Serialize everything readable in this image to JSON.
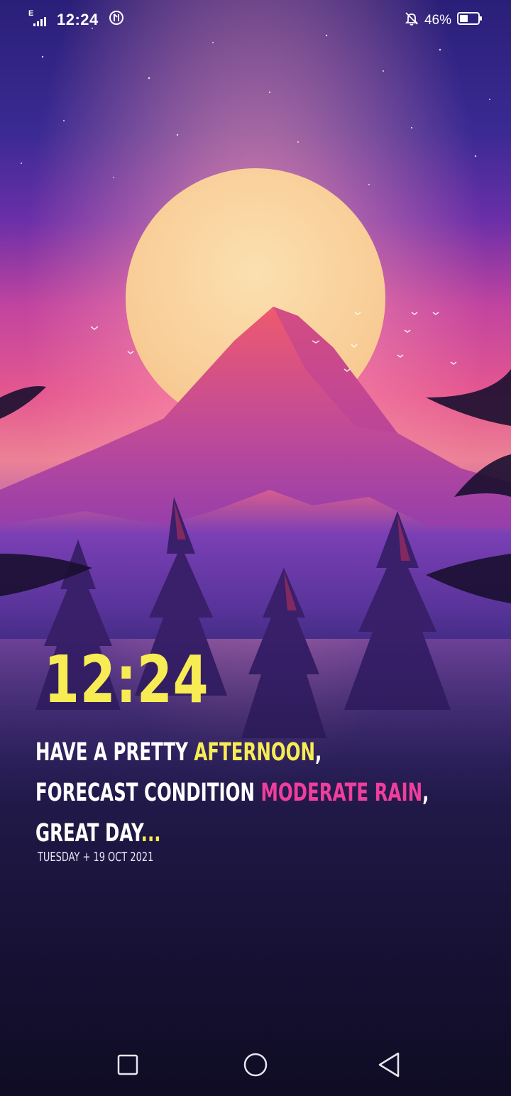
{
  "status_bar": {
    "network_type": "E",
    "time": "12:24",
    "battery_percent": "46%",
    "battery_level": 0.46,
    "icons": [
      "signal-icon",
      "data-saver-icon",
      "mute-notifications-icon",
      "battery-icon"
    ]
  },
  "widget": {
    "clock": "12:24",
    "line1": {
      "prefix": "HAVE A PRETTY ",
      "highlight": "AFTERNOON",
      "suffix": ","
    },
    "line2": {
      "prefix": "FORECAST CONDITION ",
      "highlight": "MODERATE RAIN",
      "suffix": ","
    },
    "line3": {
      "prefix": "GREAT DAY",
      "highlight": "..."
    },
    "date": "TUESDAY + 19 OCT 2021",
    "colors": {
      "clock": "#f7ec53",
      "greeting_accent": "#f7ec53",
      "weather_accent": "#ef3e9c"
    }
  },
  "nav_bar": {
    "buttons": [
      "recents-button",
      "home-button",
      "back-button"
    ]
  }
}
